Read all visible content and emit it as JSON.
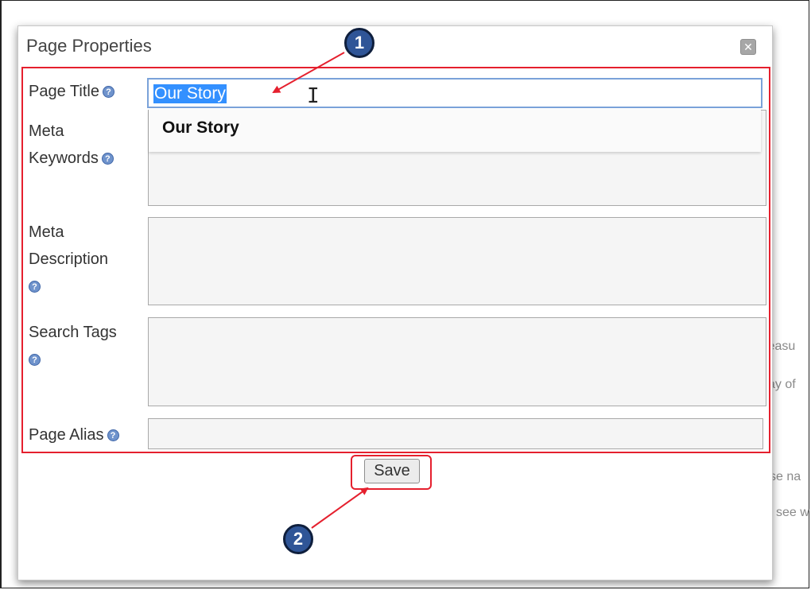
{
  "background_fragments": [
    "leasu",
    "ay of",
    "se na",
    "see w"
  ],
  "dialog": {
    "title": "Page Properties",
    "close_label": "✕",
    "fields": {
      "page_title_label": "Page Title",
      "page_title_value": "Our Story",
      "autocomplete_suggestion": "Our Story",
      "meta_keywords_label_line1": "Meta",
      "meta_keywords_label_line2": "Keywords",
      "meta_description_label_line1": "Meta",
      "meta_description_label_line2": "Description",
      "search_tags_label": "Search Tags",
      "page_alias_label": "Page Alias"
    },
    "help_glyph": "?",
    "save_label": "Save"
  },
  "annotations": {
    "callout_1": "1",
    "callout_2": "2",
    "highlight_color": "#e5202e",
    "callout_color": "#2f5597"
  },
  "icons": [
    "help-icon",
    "close-icon",
    "text-cursor-icon"
  ]
}
